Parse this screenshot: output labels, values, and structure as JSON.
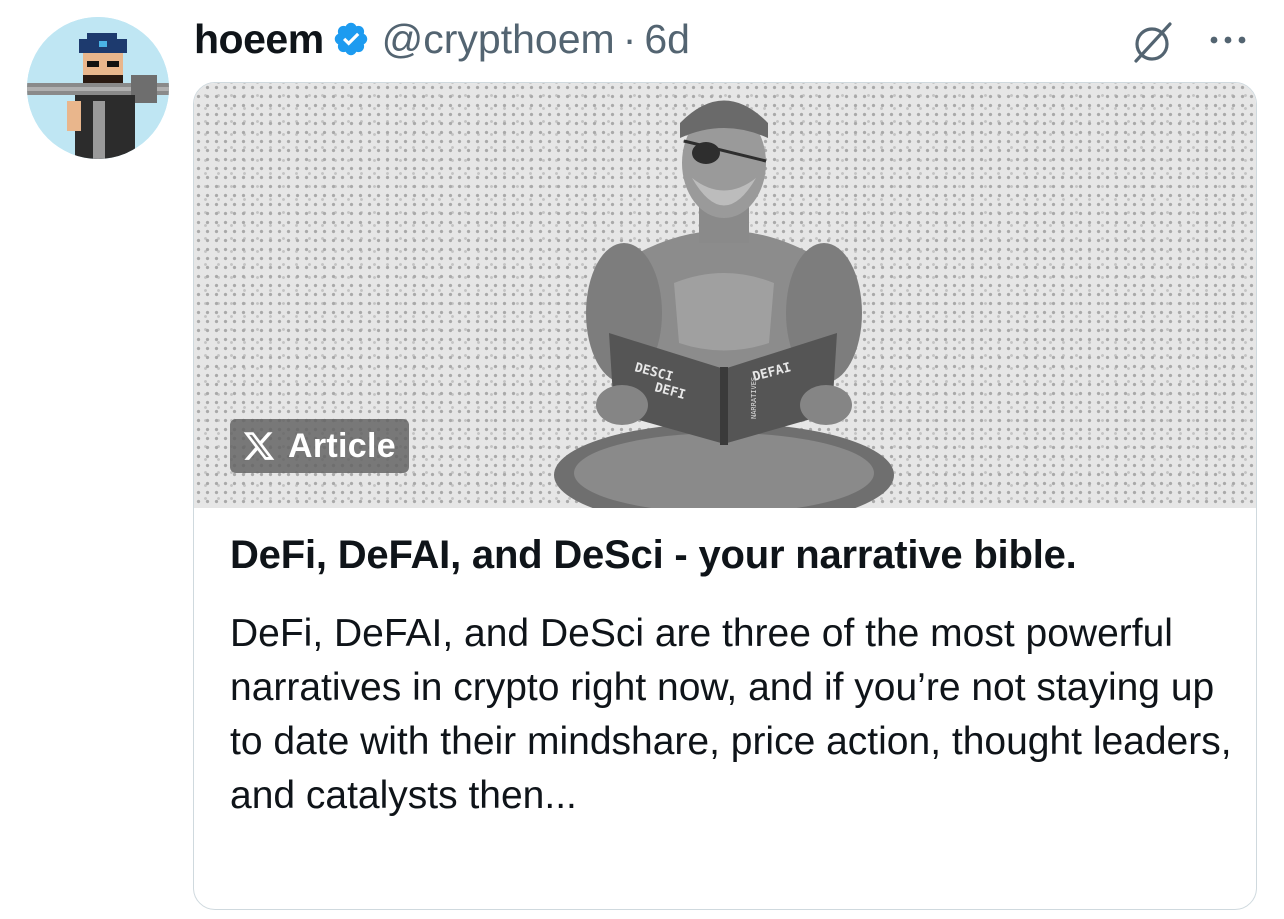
{
  "author": {
    "display_name": "hoeem",
    "handle": "@crypthoem",
    "separator": "·",
    "posted_ago": "6d",
    "verified": true
  },
  "icons": {
    "avatar": "pixel-art-avatar",
    "verified": "verified-badge-icon",
    "grok": "grok-icon",
    "more": "more-options-icon",
    "article_badge": "x-logo-icon"
  },
  "article_card": {
    "badge_label": "Article",
    "image_book_texts": [
      "DESCI",
      "DEFI",
      "DEFAI",
      "NARRATIVES"
    ],
    "title": "DeFi, DeFAI, and DeSci - your narrative bible.",
    "summary": "DeFi, DeFAI, and DeSci are three of the most powerful narratives in crypto right now, and if you’re not staying up to date with their mindshare, price action, thought leaders, and catalysts then..."
  },
  "colors": {
    "verified_blue": "#1d9bf0",
    "secondary_text": "#536471",
    "card_border": "#cfd9de"
  }
}
